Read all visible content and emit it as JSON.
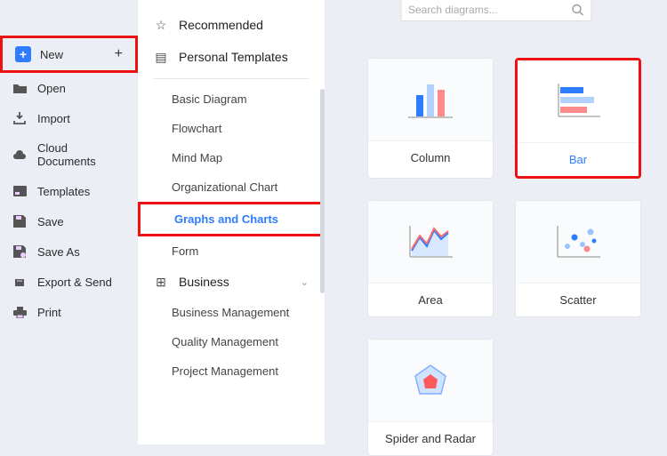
{
  "sidebar": {
    "new": "New",
    "open": "Open",
    "import": "Import",
    "cloud": "Cloud Documents",
    "templates": "Templates",
    "save": "Save",
    "saveas": "Save As",
    "export": "Export & Send",
    "print": "Print"
  },
  "panel": {
    "recommended": "Recommended",
    "personal": "Personal Templates",
    "basic": "Basic Diagram",
    "flowchart": "Flowchart",
    "mindmap": "Mind Map",
    "org": "Organizational Chart",
    "graphs": "Graphs and Charts",
    "form": "Form",
    "business": "Business",
    "bm": "Business Management",
    "qm": "Quality Management",
    "pm": "Project Management"
  },
  "search": {
    "placeholder": "Search diagrams..."
  },
  "cards": {
    "column": "Column",
    "bar": "Bar",
    "area": "Area",
    "scatter": "Scatter",
    "spider": "Spider and Radar"
  }
}
